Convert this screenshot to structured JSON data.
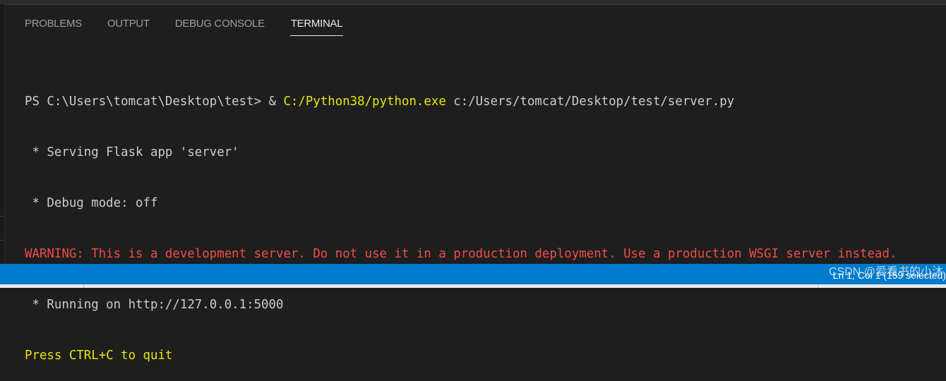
{
  "tabs": [
    {
      "label": "PROBLEMS",
      "active": false
    },
    {
      "label": "OUTPUT",
      "active": false
    },
    {
      "label": "DEBUG CONSOLE",
      "active": false
    },
    {
      "label": "TERMINAL",
      "active": true
    }
  ],
  "terminal": {
    "prompt": "PS C:\\Users\\tomcat\\Desktop\\test> & ",
    "command_exe": "C:/Python38/python.exe",
    "command_args": " c:/Users/tomcat/Desktop/test/server.py",
    "serving_line": " * Serving Flask app 'server'",
    "debug_line": " * Debug mode: off",
    "warning_line": "WARNING: This is a development server. Do not use it in a production deployment. Use a production WSGI server instead.",
    "running_line": " * Running on http://127.0.0.1:5000",
    "quit_line": "Press CTRL+C to quit"
  },
  "status_bar": {
    "cursor_position": "Ln 1, Col 1 (159 selected)",
    "watermark": "CSDN @爱看书的小沐"
  },
  "colors": {
    "terminal_background": "#1e1e1e",
    "terminal_text": "#cccccc",
    "terminal_yellow": "#e5e510",
    "terminal_red": "#f14c4c",
    "status_bar": "#007acc"
  }
}
